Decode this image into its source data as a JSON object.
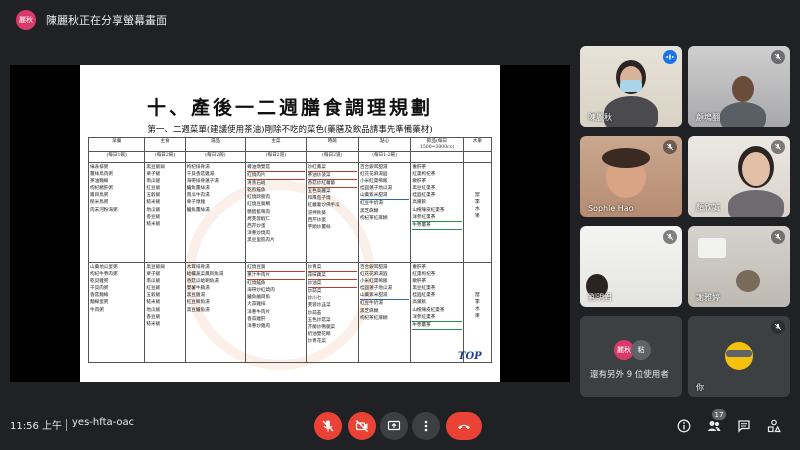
{
  "presenter": {
    "avatar_text": "麗秋",
    "notice": "陳麗秋正在分享螢幕畫面"
  },
  "slide": {
    "title": "十、產後一二週膳食調理規劃",
    "subtitle": "第一、二週菜單(建議使用茶油)剛除不吃的菜色(藥膳及飲品請事先準備藥材)",
    "headers": [
      "早餐",
      "主食",
      "湯品",
      "主菜",
      "時蔬",
      "點心",
      "飲品(每日1500~3000cc)",
      "水果"
    ],
    "subheaders": [
      "(每日1碗)",
      "(每日2碗)",
      "(每日2碗)",
      "(每日2道)",
      "(每日2道)",
      "(每日1-2碗)",
      "",
      ""
    ],
    "week1": [
      [
        "綠表排粥",
        "薑絲鳥肉粥",
        "茶油麵線",
        "枸杞豬肝粥",
        "鳳目鳥粥",
        "糙米鳥粥",
        "肉末河粉海粥"
      ],
      [
        "黑豆飯鍋",
        "栗子飯",
        "南瓜飯",
        "紅豆飯",
        "五穀飯",
        "糙米飯",
        "地瓜飯",
        "香豆飯",
        "糙米飯"
      ],
      [
        "枸杞排骨湯",
        "干貝香菇雞湯",
        "海帶排骨蓮子湯",
        "鱸魚薑絲湯",
        "南瓜牛肉湯",
        "栗子燉雞",
        "鱸魚薑絲湯"
      ],
      [
        "蠔油燉雙菇",
        "紅燒肉片",
        "清蒸石斑",
        "乾煎鮭魚",
        "紅燒蹄膀肉",
        "紅燒豆腐鯛",
        "糖醋藍莓肉",
        "烤芙蓉蝦仁",
        "西芹炒蛋",
        "洋蔥炒燒肉",
        "黑豆里肌肉片"
      ],
      [
        "炒紅鳳菜",
        "茶油炒菠菜",
        "香菇炒紅蘿蔔",
        "五色高麗菜",
        "和風茄子燒",
        "紅蘿蔔炒佛手瓜",
        "涼拌秋葵",
        "西芹炒蛋",
        "芋頭炒薑絲"
      ],
      [
        "百合銀耳甜湯",
        "紅花花麻湯圓",
        "小米紅棗稀飯",
        "桂圓蓮子地瓜湯",
        "山藥紫米甜湯",
        "紅豆牛奶湯",
        "黑芝麻糊",
        "枸杞茶紅麻糊"
      ],
      [
        "養肝茶",
        "紅棗枸杞茶",
        "敏肝茶",
        "黑豆紅棗茶",
        "桂圓紅棗茶",
        "高纖飲",
        "山楂陳皮紅棗茶",
        "洋參紅棗茶",
        "牛蒡薑茶"
      ],
      [
        "當",
        "季",
        "水",
        "果"
      ]
    ],
    "week2": [
      [
        "山藥地瓜蛋粥",
        "枸杞牛蒡肉粥",
        "乾貝雞粥",
        "干貝肉粥",
        "香菇麵線",
        "麵線蛋粥",
        "牛肉粥"
      ],
      [
        "黑豆飯鍋",
        "栗子飯",
        "南瓜飯",
        "紅豆飯",
        "五穀飯",
        "糙米飯",
        "地瓜飯",
        "香豆飯",
        "糙米飯"
      ],
      [
        "木耳排骨湯",
        "蛤蠣蔬菜鳳目魚湯",
        "香菇瓜蛤蜊魚湯",
        "雙薯牛腩湯",
        "黑豆雞湯",
        "紅豆鯽魚湯",
        "黑豆鱸魚湯"
      ],
      [
        "紅燒豆腐",
        "蔥汁牛肉片",
        "紅燒鮭魚",
        "海帶炒紅燒肉",
        "鱸魚鹹目魚",
        "大蒜雞排",
        "洋蔥牛肉片",
        "香蒜雞肝",
        "洋蔥炒雞肉"
      ],
      [
        "炒青菜",
        "蒜味藕菜",
        "炒油菜",
        "炒蒜菜",
        "炒川七",
        "芙蓉炒韭菜",
        "炒蒜苔",
        "五色炒菇菜",
        "芥蘭炒鴨腿菜",
        "奶油雙花椰",
        "炒青花菜"
      ],
      [
        "百合銀耳甜湯",
        "紅花花麻湯圓",
        "小米紅棗稀飯",
        "桂圓蓮子地瓜湯",
        "山藥紫米甜湯",
        "紅豆牛奶湯",
        "黑芝麻糊",
        "枸杞茶紅麻糊"
      ],
      [
        "養肝茶",
        "紅棗枸杞茶",
        "敏肝茶",
        "黑豆紅棗茶",
        "桂圓紅棗茶",
        "高纖飲",
        "山楂陳皮紅棗茶",
        "洋參紅棗茶",
        "牛蒡薑茶"
      ],
      [
        "當",
        "季",
        "水",
        "果"
      ]
    ],
    "logo_text": "TOP"
  },
  "tiles": [
    {
      "name": "陳麗秋",
      "state": "speaking"
    },
    {
      "name": "顧塢翻",
      "state": "muted"
    },
    {
      "name": "Sophie Hao",
      "state": "muted"
    },
    {
      "name": "顏欣誠",
      "state": "muted"
    },
    {
      "name": "劉明君",
      "state": "muted"
    },
    {
      "name": "謝雅婷",
      "state": "muted"
    }
  ],
  "others": {
    "avatar1": "麗秋",
    "avatar2": "粘",
    "text": "還有另外 9 位使用者"
  },
  "self": {
    "name": "你"
  },
  "bottom": {
    "time": "11:56 上午",
    "meeting_code": "yes-hfta-oac",
    "participants_count": "17"
  },
  "colors": {
    "background": "#202124",
    "danger": "#ea4335",
    "accent": "#1a73e8",
    "tile": "#3c4043"
  }
}
